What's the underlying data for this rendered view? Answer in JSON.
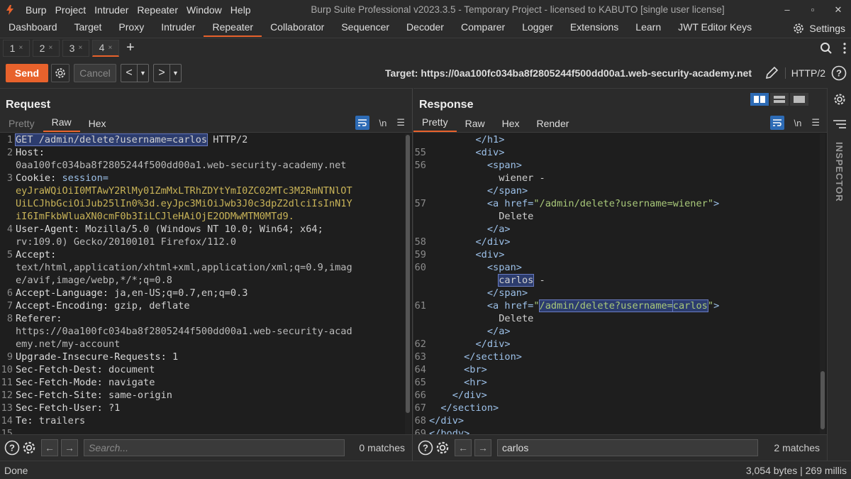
{
  "window": {
    "title": "Burp Suite Professional v2023.3.5 - Temporary Project - licensed to KABUTO [single user license]",
    "menu": [
      "Burp",
      "Project",
      "Intruder",
      "Repeater",
      "Window",
      "Help"
    ],
    "controls": [
      "–",
      "▫",
      "✕"
    ]
  },
  "main_tabs": [
    "Dashboard",
    "Target",
    "Proxy",
    "Intruder",
    "Repeater",
    "Collaborator",
    "Sequencer",
    "Decoder",
    "Comparer",
    "Logger",
    "Extensions",
    "Learn",
    "JWT Editor Keys"
  ],
  "main_tab_active": "Repeater",
  "settings_label": "Settings",
  "sub_tabs": [
    {
      "label": "1",
      "close": "×"
    },
    {
      "label": "2",
      "close": "×"
    },
    {
      "label": "3",
      "close": "×"
    },
    {
      "label": "4",
      "close": "×"
    }
  ],
  "plus": "+",
  "toolbar": {
    "send": "Send",
    "cancel": "Cancel",
    "target_label": "Target:",
    "target_url": "https://0aa100fc034ba8f2805244f500dd00a1.web-security-academy.net",
    "protocol": "HTTP/2"
  },
  "request": {
    "title": "Request",
    "tabs": [
      "Pretty",
      "Raw",
      "Hex"
    ],
    "active_tab": "Raw",
    "newline_label": "\\n",
    "search_placeholder": "Search...",
    "matches": "0 matches"
  },
  "response": {
    "title": "Response",
    "tabs": [
      "Pretty",
      "Raw",
      "Hex",
      "Render"
    ],
    "active_tab": "Pretty",
    "newline_label": "\\n",
    "search_value": "carlos",
    "matches": "2 matches"
  },
  "inspector_label": "INSPECTOR",
  "status": {
    "left": "Done",
    "right": "3,054 bytes | 269 millis"
  },
  "colors": {
    "accent": "#e8622c",
    "blue": "#2d6bb5",
    "highlight": "#2c3c6e"
  }
}
